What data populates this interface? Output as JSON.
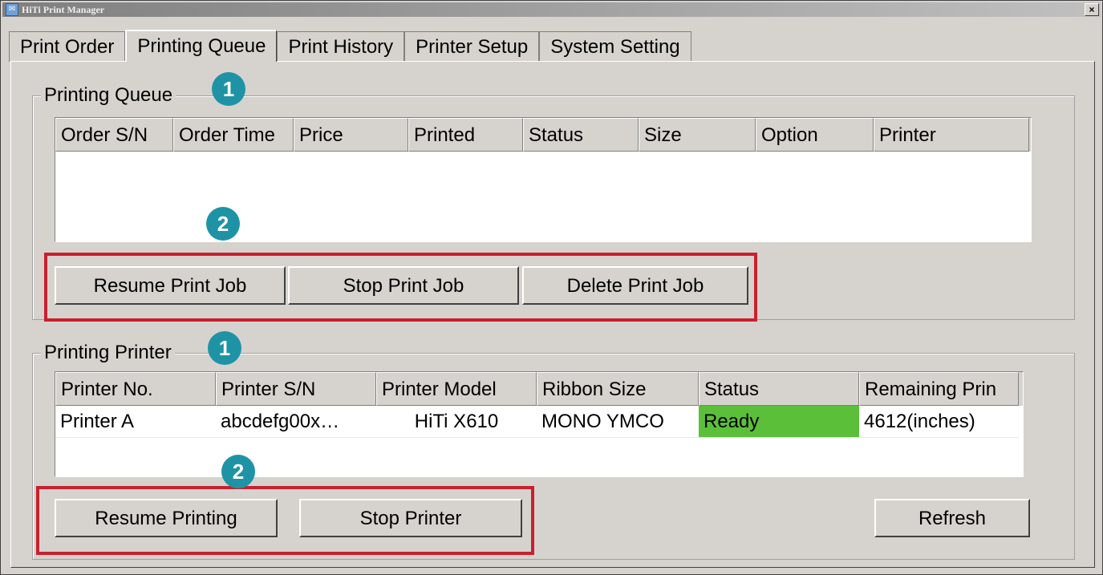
{
  "window": {
    "title": "HiTi Print Manager",
    "close_label": "×"
  },
  "tabs": [
    {
      "label": "Print Order",
      "active": false
    },
    {
      "label": "Printing Queue",
      "active": true
    },
    {
      "label": "Print History",
      "active": false
    },
    {
      "label": "Printer Setup",
      "active": false
    },
    {
      "label": "System Setting",
      "active": false
    }
  ],
  "queue": {
    "group_label": "Printing Queue",
    "badge_1": "1",
    "badge_2": "2",
    "columns": [
      "Order S/N",
      "Order Time",
      "Price",
      "Printed",
      "Status",
      "Size",
      "Option",
      "Printer"
    ],
    "rows": [],
    "buttons": {
      "resume": "Resume Print Job",
      "stop": "Stop Print Job",
      "delete": "Delete Print Job"
    }
  },
  "printer": {
    "group_label": "Printing Printer",
    "badge_1": "1",
    "badge_2": "2",
    "columns": [
      "Printer No.",
      "Printer S/N",
      "Printer Model",
      "Ribbon Size",
      "Status",
      "Remaining Prin"
    ],
    "rows": [
      {
        "no": "Printer A",
        "sn": "abcdefg00x…",
        "model": "HiTi X610",
        "ribbon": "MONO YMCO",
        "status": "Ready",
        "remaining": "4612(inches)"
      }
    ],
    "buttons": {
      "resume": "Resume Printing",
      "stop": "Stop Printer",
      "refresh": "Refresh"
    }
  },
  "colors": {
    "badge": "#1f93a6",
    "highlight": "#c8202e",
    "status_ready": "#5cbf3a"
  }
}
